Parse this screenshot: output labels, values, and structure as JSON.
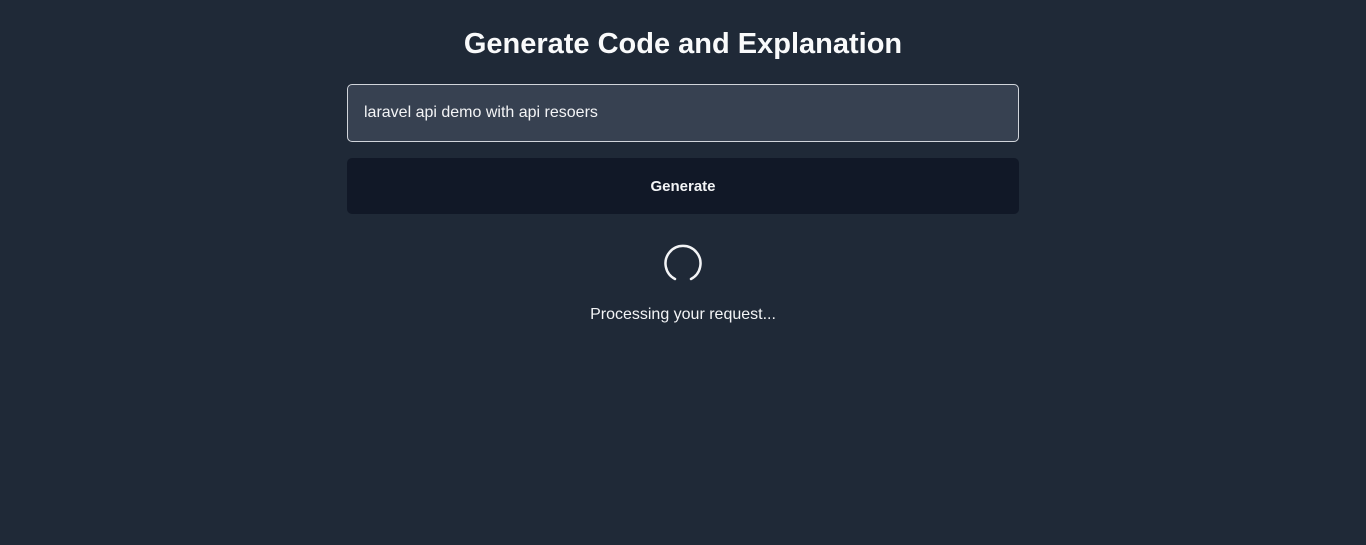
{
  "header": {
    "title": "Generate Code and Explanation"
  },
  "form": {
    "prompt_value": "laravel api demo with api resoers",
    "generate_label": "Generate"
  },
  "status": {
    "loading_icon": "spinner-icon",
    "message": "Processing your request..."
  },
  "colors": {
    "background": "#1f2937",
    "input_background": "#374151",
    "button_background": "#111827",
    "text": "#f3f4f6"
  }
}
